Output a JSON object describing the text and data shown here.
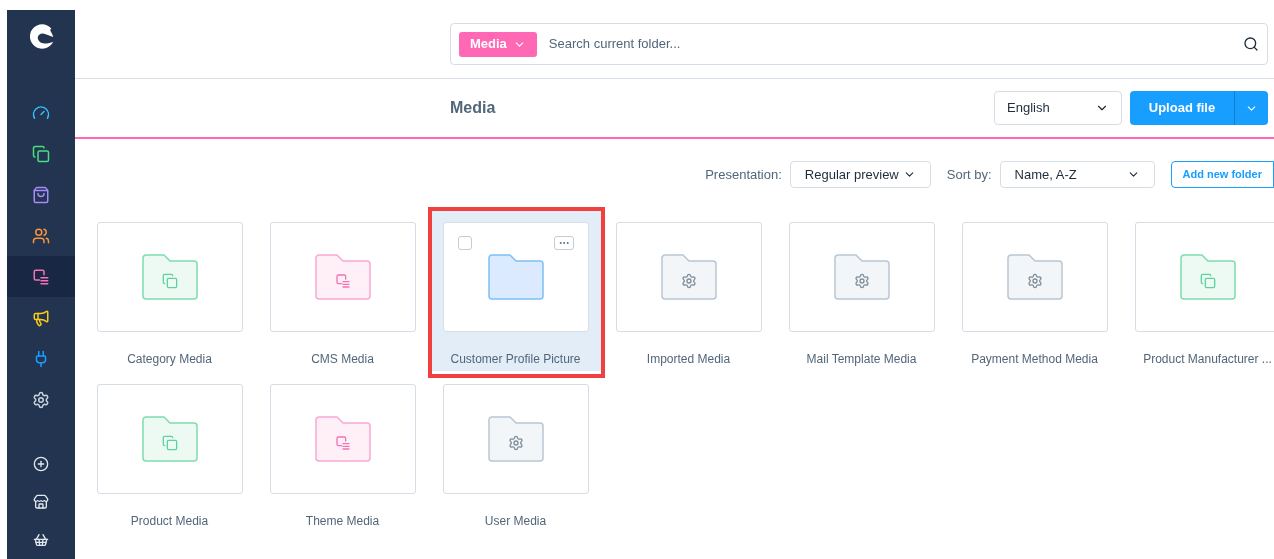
{
  "sidebar": {
    "items": [
      {
        "kind": "dashboard",
        "selected": false
      },
      {
        "kind": "catalog",
        "selected": false
      },
      {
        "kind": "orders",
        "selected": false
      },
      {
        "kind": "customers",
        "selected": false
      },
      {
        "kind": "content",
        "selected": true
      },
      {
        "kind": "marketing",
        "selected": false
      },
      {
        "kind": "extensions",
        "selected": false
      },
      {
        "kind": "settings",
        "selected": false
      }
    ],
    "bottom_items": [
      {
        "kind": "add"
      },
      {
        "kind": "store"
      },
      {
        "kind": "basket"
      }
    ]
  },
  "search": {
    "scope": "Media",
    "placeholder": "Search current folder..."
  },
  "header": {
    "title": "Media",
    "language": "English",
    "upload_button": "Upload file"
  },
  "toolbar": {
    "presentation_label": "Presentation:",
    "presentation_value": "Regular preview",
    "sort_label": "Sort by:",
    "sort_value": "Name, A-Z",
    "add_folder_button": "Add new folder"
  },
  "folders": [
    {
      "name": "Category Media",
      "kind": "catalog",
      "selected": false
    },
    {
      "name": "CMS Media",
      "kind": "content",
      "selected": false
    },
    {
      "name": "Customer Profile Picture",
      "kind": "plain",
      "selected": true,
      "checked": false
    },
    {
      "name": "Imported Media",
      "kind": "system",
      "selected": false
    },
    {
      "name": "Mail Template Media",
      "kind": "system",
      "selected": false
    },
    {
      "name": "Payment Method Media",
      "kind": "system",
      "selected": false
    },
    {
      "name": "Product Manufacturer ...",
      "kind": "catalog",
      "selected": false
    },
    {
      "name": "Product Media",
      "kind": "catalog",
      "selected": false
    },
    {
      "name": "Theme Media",
      "kind": "content",
      "selected": false
    },
    {
      "name": "User Media",
      "kind": "system",
      "selected": false
    }
  ]
}
